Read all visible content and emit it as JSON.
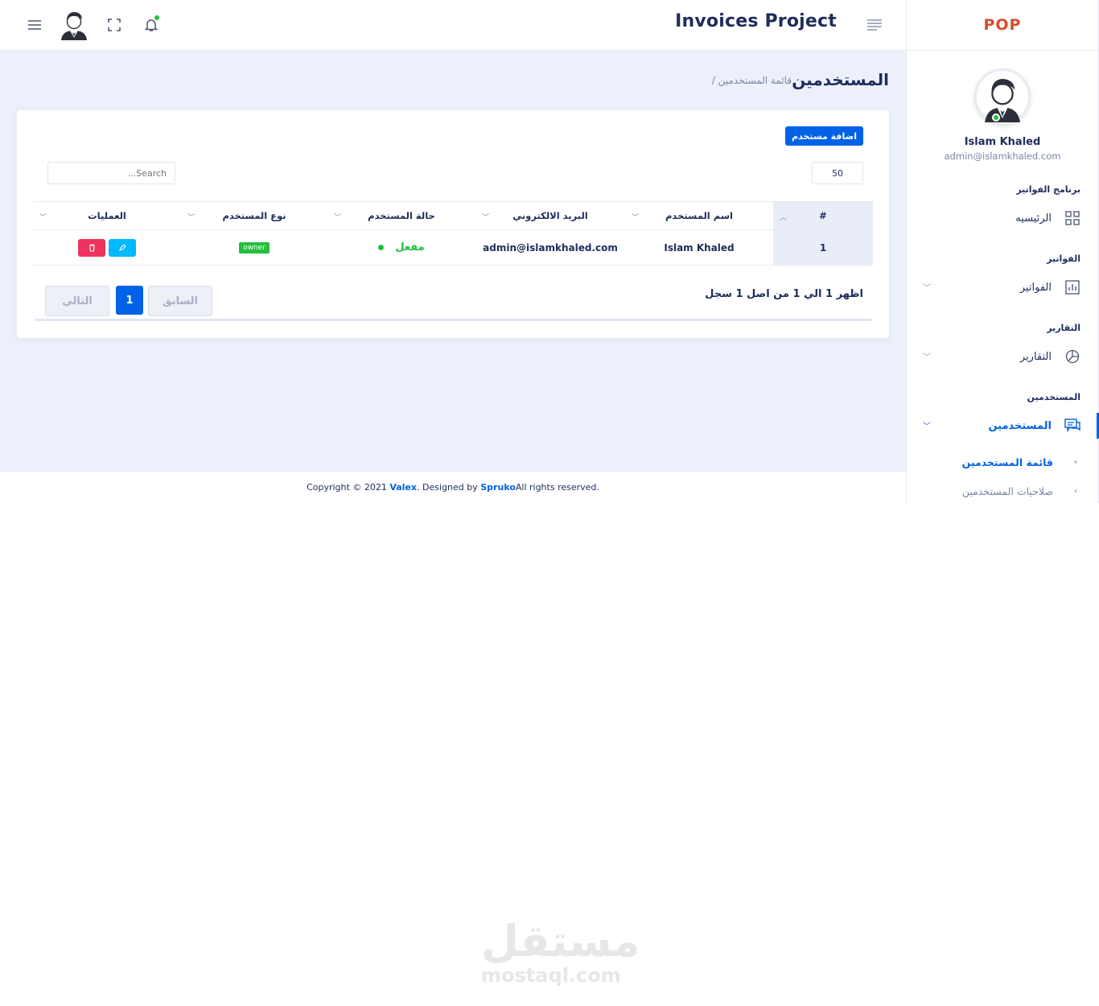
{
  "sidebar": {
    "logo": "POP",
    "profile": {
      "name": "Islam Khaled",
      "email": "admin@islamkhaled.com"
    },
    "sections": [
      {
        "label": "برنامج الفواتير",
        "item": "الرئيسيه",
        "icon": "dashboard-grid-icon"
      },
      {
        "label": "الفواتير",
        "item": "الفواتير",
        "icon": "bar-chart-icon"
      },
      {
        "label": "التقارير",
        "item": "التقارير",
        "icon": "pie-chart-icon"
      },
      {
        "label": "المستخدمين",
        "item": "المستخدمين",
        "icon": "users-chat-icon"
      }
    ],
    "sub_items": [
      "قائمة المستخدمين",
      "صلاحيات المستخدمين"
    ]
  },
  "header": {
    "title": "Invoices Project"
  },
  "main": {
    "page_title": "المستخدمين",
    "breadcrumb": "/ قائمة المستخدمين",
    "add_button": "اضافة مستخدم",
    "page_length": "50",
    "search_placeholder": "...Search",
    "columns": [
      "#",
      "اسم المستخدم",
      "البريد الالكتروني",
      "حالة المستخدم",
      "نوع المستخدم",
      "العمليات"
    ],
    "rows": [
      {
        "num": "1",
        "name": "Islam Khaled",
        "email": "admin@islamkhaled.com",
        "status": "مفعل",
        "role": "owner"
      }
    ],
    "info": "اظهر 1 الي 1 من اصل 1 سجل",
    "pager": {
      "prev": "السابق",
      "current": "1",
      "next": "التالي"
    }
  },
  "footer": {
    "prefix": "Copyright © 2021 ",
    "brand": "Valex",
    "middle": ". Designed by ",
    "designer": "Spruko",
    "suffix": " All rights reserved."
  },
  "watermark": {
    "arabic": "مستقل",
    "latin": "mostaql.com"
  },
  "colors": {
    "primary": "#0162e8",
    "success": "#22c03c",
    "danger": "#ee335e",
    "info": "#00b9ff",
    "text": "#1f2d5c",
    "muted": "#7987a1",
    "body_bg": "#ecf0fa"
  }
}
